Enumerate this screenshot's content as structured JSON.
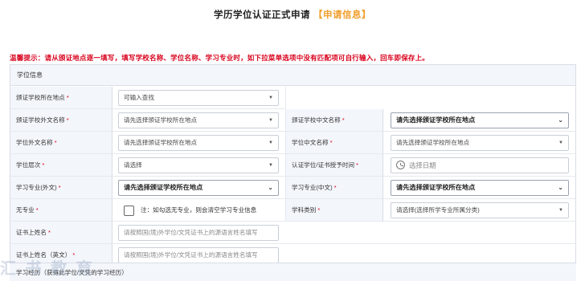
{
  "header": {
    "title": "学历学位认证正式申请",
    "highlight": "【申请信息】"
  },
  "tip": "温馨提示：请从颁证地点逐一填写，填写学校名称、学位名称、学习专业时，如下拉菜单选项中没有匹配项可自行输入，回车即保存上。",
  "section": {
    "title": "学位信息",
    "footer": "学习经历（获得此学位/文凭的学习经历）",
    "watermark": "汇 书 教 育"
  },
  "required_mark": "*",
  "form": {
    "location": {
      "label": "颁证学校所在地点",
      "value": "可输入查找"
    },
    "school_foreign": {
      "label": "颁证学校外文名称",
      "value": "请先选择颁证学校所在地点"
    },
    "school_chinese": {
      "label": "颁证学校中文名称",
      "value": "请先选择颁证学校所在地点"
    },
    "degree_foreign": {
      "label": "学位外文名称",
      "value": "请先选择颁证学校所在地点"
    },
    "degree_chinese": {
      "label": "学位中文名称",
      "value": "请先选择颁证学校所在地点"
    },
    "degree_level": {
      "label": "学位层次",
      "value": "请选择"
    },
    "award_time": {
      "label": "认证学位/证书授予时间",
      "placeholder": "选择日期"
    },
    "major_foreign": {
      "label": "学习专业(外文)",
      "value": "请先选择颁证学校所在地点"
    },
    "major_chinese": {
      "label": "学习专业(中文)",
      "value": "请先选择颁证学校所在地点"
    },
    "no_major": {
      "label": "无专业",
      "note": "注：如勾选无专业，则会清空学习专业信息"
    },
    "discipline": {
      "label": "学科类别",
      "value": "请选择(选择所学专业所属分类)"
    },
    "cert_name": {
      "label": "证书上姓名",
      "placeholder": "请按照国(境)外学位/文凭证书上的源语言姓名填写"
    },
    "cert_name_en": {
      "label": "证书上姓名（英文）",
      "placeholder": "请按照国(境)外学位/文凭证书上的源语言姓名填写"
    }
  }
}
